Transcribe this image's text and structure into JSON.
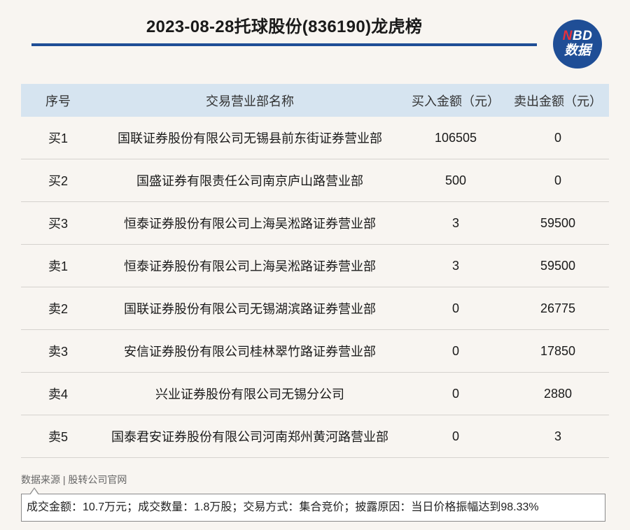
{
  "header": {
    "title": "2023-08-28托球股份(836190)龙虎榜",
    "logo_line1_n": "N",
    "logo_line1_rest": "BD",
    "logo_line2": "数据"
  },
  "colors": {
    "brand_blue": "#1f4e96",
    "header_bg": "#d6e4f0",
    "logo_accent": "#e8313c"
  },
  "table": {
    "columns": [
      "序号",
      "交易营业部名称",
      "买入金额（元）",
      "卖出金额（元）"
    ],
    "rows": [
      {
        "seq": "买1",
        "name": "国联证券股份有限公司无锡县前东街证券营业部",
        "buy": "106505",
        "sell": "0"
      },
      {
        "seq": "买2",
        "name": "国盛证券有限责任公司南京庐山路营业部",
        "buy": "500",
        "sell": "0"
      },
      {
        "seq": "买3",
        "name": "恒泰证券股份有限公司上海吴淞路证券营业部",
        "buy": "3",
        "sell": "59500"
      },
      {
        "seq": "卖1",
        "name": "恒泰证券股份有限公司上海吴淞路证券营业部",
        "buy": "3",
        "sell": "59500"
      },
      {
        "seq": "卖2",
        "name": "国联证券股份有限公司无锡湖滨路证券营业部",
        "buy": "0",
        "sell": "26775"
      },
      {
        "seq": "卖3",
        "name": "安信证券股份有限公司桂林翠竹路证券营业部",
        "buy": "0",
        "sell": "17850"
      },
      {
        "seq": "卖4",
        "name": "兴业证券股份有限公司无锡分公司",
        "buy": "0",
        "sell": "2880"
      },
      {
        "seq": "卖5",
        "name": "国泰君安证券股份有限公司河南郑州黄河路营业部",
        "buy": "0",
        "sell": "3"
      }
    ]
  },
  "footer": {
    "source": "数据来源 | 股转公司官网",
    "note": "成交金额：10.7万元；成交数量：1.8万股；交易方式：集合竞价；披露原因：当日价格振幅达到98.33%"
  }
}
